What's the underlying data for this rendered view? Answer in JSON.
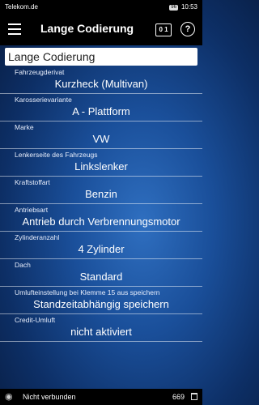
{
  "status_bar": {
    "carrier": "Telekom.de",
    "battery": "96",
    "time": "10:53"
  },
  "app_bar": {
    "title": "Lange Codierung",
    "toggle_label": "0 1"
  },
  "section_heading": "Lange Codierung",
  "fields": [
    {
      "label": "Fahrzeugderivat",
      "value": "Kurzheck (Multivan)"
    },
    {
      "label": "Karosserievariante",
      "value": "A - Plattform"
    },
    {
      "label": "Marke",
      "value": "VW"
    },
    {
      "label": "Lenkerseite des Fahrzeugs",
      "value": "Linkslenker"
    },
    {
      "label": "Kraftstoffart",
      "value": "Benzin"
    },
    {
      "label": "Antriebsart",
      "value": "Antrieb durch Verbrennungsmotor"
    },
    {
      "label": "Zylinderanzahl",
      "value": "4 Zylinder"
    },
    {
      "label": "Dach",
      "value": "Standard"
    },
    {
      "label": "Umlufteinstellung bei Klemme 15 aus speichern",
      "value": "Standzeitabhängig speichern"
    },
    {
      "label": "Credit-Umluft",
      "value": "nicht aktiviert"
    }
  ],
  "bottom_bar": {
    "connection_status": "Nicht verbunden",
    "count": "669"
  }
}
